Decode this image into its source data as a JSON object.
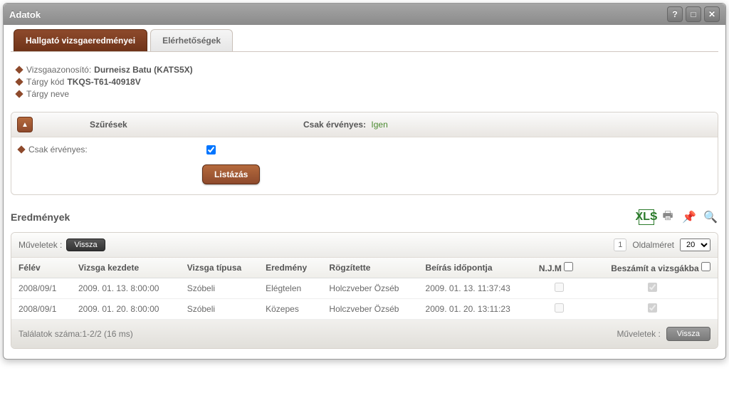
{
  "window": {
    "title": "Adatok"
  },
  "tabs": {
    "active": "Hallgató vizsgaeredményei",
    "other": "Elérhetőségek"
  },
  "info": {
    "id_label": "Vizsgaazonosító:",
    "id_value": "Durneisz Batu (KATS5X)",
    "code_label": "Tárgy kód",
    "code_value": "TKQS-T61-40918V",
    "name_label": "Tárgy neve",
    "name_value": ""
  },
  "filter": {
    "title": "Szűrések",
    "valid_label": "Csak érvényes:",
    "valid_value": "Igen",
    "row_label": "Csak érvényes:",
    "checked": true,
    "list_btn": "Listázás"
  },
  "results": {
    "heading": "Eredmények"
  },
  "grid": {
    "ops_label": "Műveletek :",
    "back_btn": "Vissza",
    "page": "1",
    "page_size_label": "Oldalméret",
    "page_size": "20",
    "headers": {
      "term": "Félév",
      "start": "Vizsga kezdete",
      "type": "Vizsga típusa",
      "grade": "Eredmény",
      "recorder": "Rögzítette",
      "entered": "Beírás időpontja",
      "njm": "N.J.M",
      "counts": "Beszámít a vizsgákba"
    },
    "rows": [
      {
        "term": "2008/09/1",
        "start": "2009. 01. 13. 8:00:00",
        "type": "Szóbeli",
        "grade": "Elégtelen",
        "recorder": "Holczveber Özséb",
        "entered": "2009. 01. 13. 11:37:43",
        "njm": false,
        "counts": true
      },
      {
        "term": "2008/09/1",
        "start": "2009. 01. 20. 8:00:00",
        "type": "Szóbeli",
        "grade": "Közepes",
        "recorder": "Holczveber Özséb",
        "entered": "2009. 01. 20. 13:11:23",
        "njm": false,
        "counts": true
      }
    ],
    "footer": {
      "count_text": "Találatok száma:1-2/2 (16 ms)",
      "ops_label": "Műveletek :",
      "back_btn": "Vissza"
    }
  }
}
